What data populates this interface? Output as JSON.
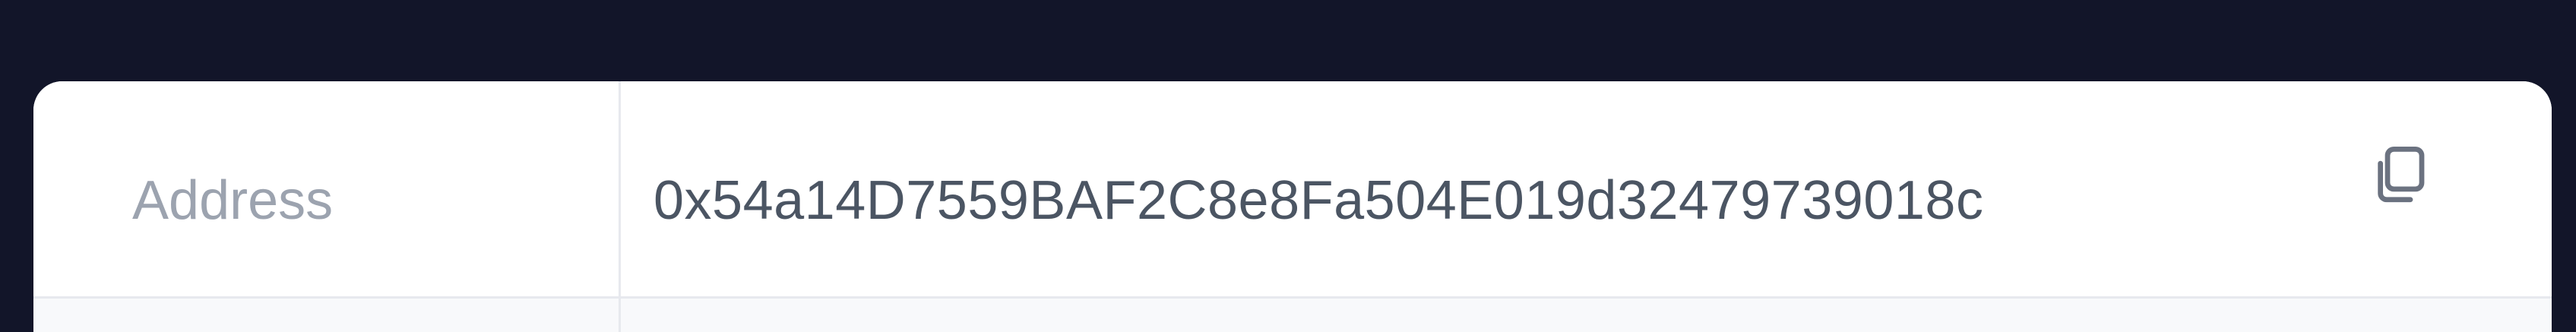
{
  "address_row": {
    "label": "Address",
    "value": "0x54a14D7559BAF2C8e8Fa504E019d32479739018c",
    "copy_icon": "copy-icon"
  },
  "colors": {
    "page_background": "#121529",
    "panel_background": "#ffffff",
    "label_text": "#9ca3af",
    "value_text": "#4b5563",
    "icon_stroke": "#6b7280",
    "divider": "#e7e9ee"
  }
}
